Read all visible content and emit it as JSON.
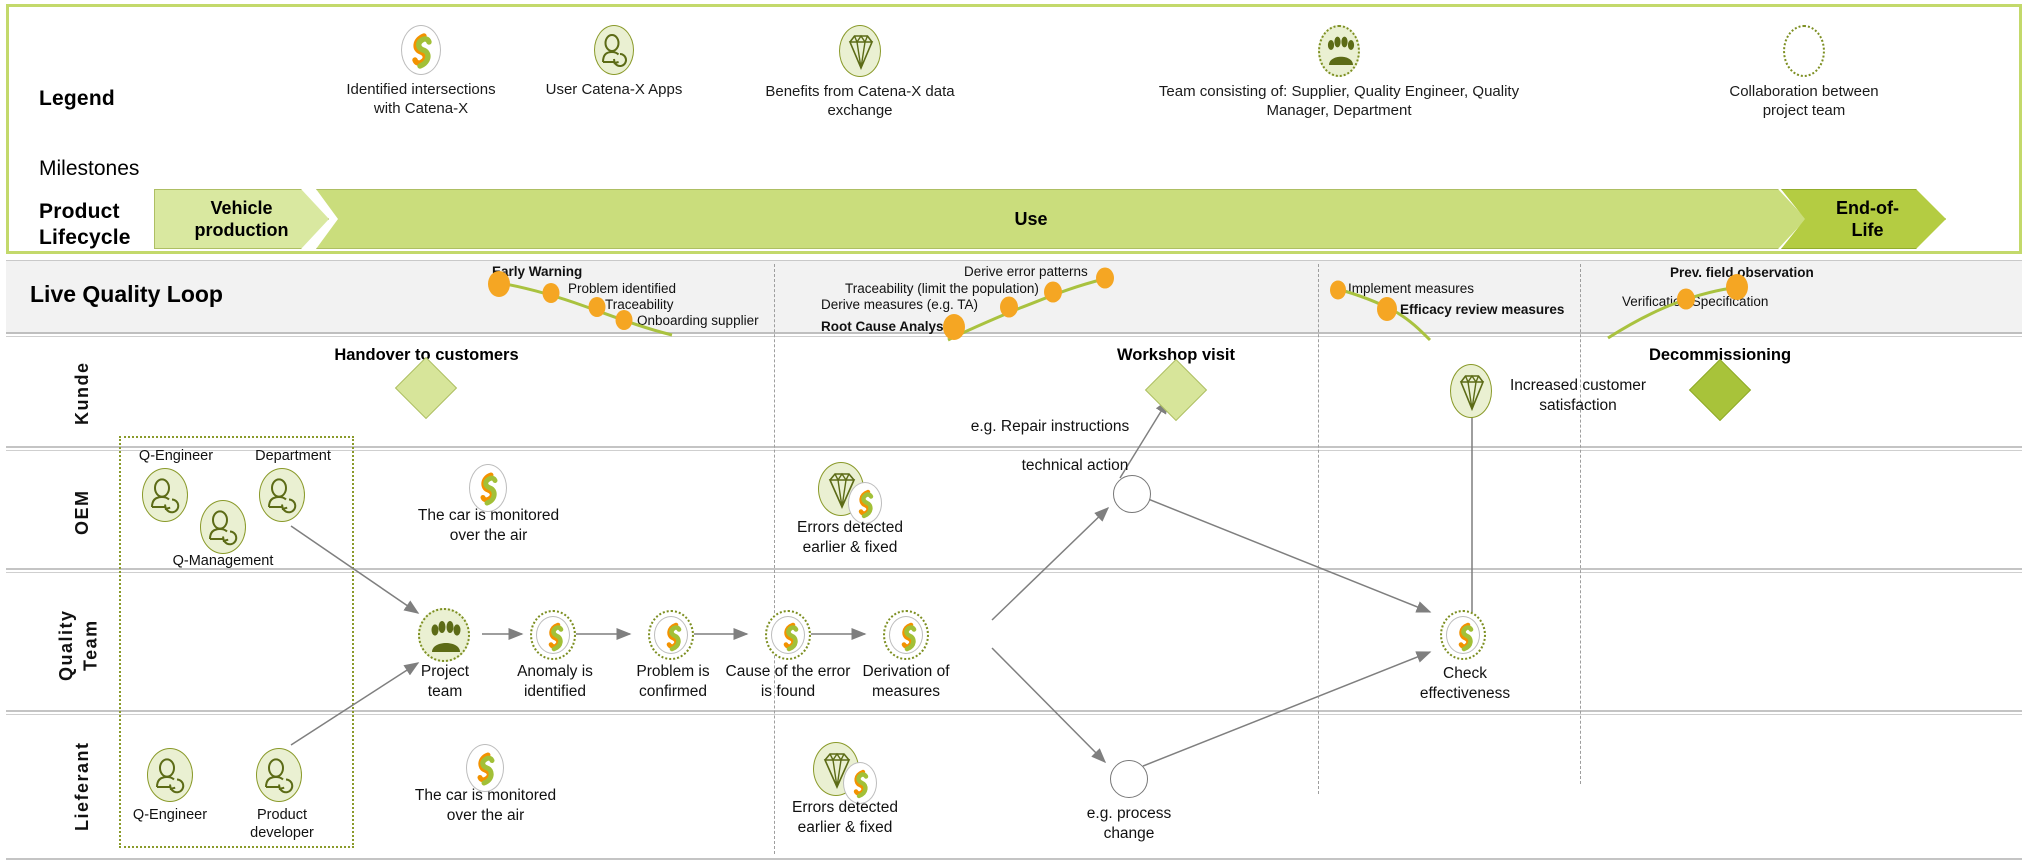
{
  "legend": {
    "title": "Legend",
    "items": [
      {
        "icon": "catena-x-logo-icon",
        "caption_line1": "Identified intersections",
        "caption_line2": "with Catena-X"
      },
      {
        "icon": "user-apps-icon",
        "caption_line1": "User Catena-X Apps",
        "caption_line2": ""
      },
      {
        "icon": "diamond-benefit-icon",
        "caption_line1": "Benefits from Catena-X data",
        "caption_line2": "exchange"
      },
      {
        "icon": "team-group-icon",
        "caption_line1": "Team consisting of: Supplier, Quality Engineer, Quality",
        "caption_line2": "Manager, Department"
      },
      {
        "icon": "dotted-ellipse-icon",
        "caption_line1": "Collaboration between",
        "caption_line2": "project team"
      }
    ]
  },
  "milestones": {
    "title": "Milestones"
  },
  "lifecycle": {
    "title_line1": "Product",
    "title_line2": "Lifecycle",
    "phases": [
      {
        "label": "Vehicle production",
        "label_line1": "Vehicle",
        "label_line2": "production"
      },
      {
        "label": "Use",
        "label_line1": "Use",
        "label_line2": ""
      },
      {
        "label": "End-of-Life",
        "label_line1": "End-of-",
        "label_line2": "Life"
      }
    ]
  },
  "live_quality_loop": {
    "title": "Live Quality Loop",
    "groups": [
      {
        "name": "group-1",
        "points": [
          {
            "label": "Early Warning",
            "bold": true
          },
          {
            "label": "Problem identified",
            "bold": false
          },
          {
            "label": "Traceability",
            "bold": false
          },
          {
            "label": "Onboarding supplier",
            "bold": false
          }
        ]
      },
      {
        "name": "group-2",
        "points": [
          {
            "label": "Derive error patterns",
            "bold": false
          },
          {
            "label": "Traceability (limit the population)",
            "bold": false
          },
          {
            "label": "Derive measures (e.g. TA)",
            "bold": false
          },
          {
            "label": "Root Cause Analysis",
            "bold": true
          }
        ]
      },
      {
        "name": "group-3",
        "points": [
          {
            "label": "Implement measures",
            "bold": false
          },
          {
            "label": "Efficacy review measures",
            "bold": true
          }
        ]
      },
      {
        "name": "group-4",
        "points": [
          {
            "label": "Prev. field observation",
            "bold": true
          },
          {
            "label": "Verification Specification",
            "bold": false
          }
        ]
      }
    ]
  },
  "lanes": [
    {
      "name": "Kunde",
      "milestones": [
        {
          "title": "Handover to customers",
          "shape": "diamond-light"
        },
        {
          "title": "Workshop visit",
          "shape": "diamond-light"
        },
        {
          "title": "Decommissioning",
          "shape": "diamond-dark"
        }
      ],
      "nodes": [
        {
          "icon": "diamond-benefit-icon",
          "caption_line1": "Increased customer",
          "caption_line2": "satisfaction"
        }
      ],
      "edge_labels": [
        "e.g. Repair instructions"
      ]
    },
    {
      "name": "OEM",
      "nodes": [
        {
          "icon": "user-apps-icon",
          "caption_line1": "Q-Engineer",
          "caption_line2": ""
        },
        {
          "icon": "user-apps-icon",
          "caption_line1": "Department",
          "caption_line2": ""
        },
        {
          "icon": "user-apps-icon",
          "caption_line1": "Q-Management",
          "caption_line2": ""
        },
        {
          "icon": "catena-x-logo-icon",
          "caption_line1": "The car is monitored",
          "caption_line2": "over the air"
        },
        {
          "icon": "diamond-benefit-icon",
          "caption_line1": "Errors detected",
          "caption_line2": "earlier & fixed"
        }
      ],
      "edge_labels": [
        "technical action"
      ]
    },
    {
      "name": "Quality Team",
      "name_line1": "Quality",
      "name_line2": "Team",
      "nodes": [
        {
          "icon": "team-group-icon",
          "caption_line1": "Project",
          "caption_line2": "team"
        },
        {
          "icon": "catena-x-logo-icon",
          "caption_line1": "Anomaly is",
          "caption_line2": "identified"
        },
        {
          "icon": "catena-x-logo-icon",
          "caption_line1": "Problem is",
          "caption_line2": "confirmed"
        },
        {
          "icon": "catena-x-logo-icon",
          "caption_line1": "Cause of the error",
          "caption_line2": "is found"
        },
        {
          "icon": "catena-x-logo-icon",
          "caption_line1": "Derivation of",
          "caption_line2": "measures"
        },
        {
          "icon": "catena-x-logo-icon",
          "caption_line1": "Check",
          "caption_line2": "effectiveness"
        }
      ]
    },
    {
      "name": "Lieferant",
      "nodes": [
        {
          "icon": "user-apps-icon",
          "caption_line1": "Q-Engineer",
          "caption_line2": ""
        },
        {
          "icon": "user-apps-icon",
          "caption_line1": "Product",
          "caption_line2": "developer"
        },
        {
          "icon": "catena-x-logo-icon",
          "caption_line1": "The car is monitored",
          "caption_line2": "over the air"
        },
        {
          "icon": "diamond-benefit-icon",
          "caption_line1": "Errors detected",
          "caption_line2": "earlier & fixed"
        }
      ],
      "edge_labels": [
        "e.g. process",
        "change"
      ]
    }
  ],
  "colors": {
    "frame_green": "#c3d96b",
    "chevron_light": "#d9e8a0",
    "chevron_mid": "#cadd7c",
    "chevron_dark": "#b4cc42",
    "icon_fill_green": "#eaf0d2",
    "icon_stroke_green": "#7d8f22",
    "orange": "#f5a623",
    "loop_line": "#a9c23f",
    "band_bg": "#f2f2f2"
  }
}
